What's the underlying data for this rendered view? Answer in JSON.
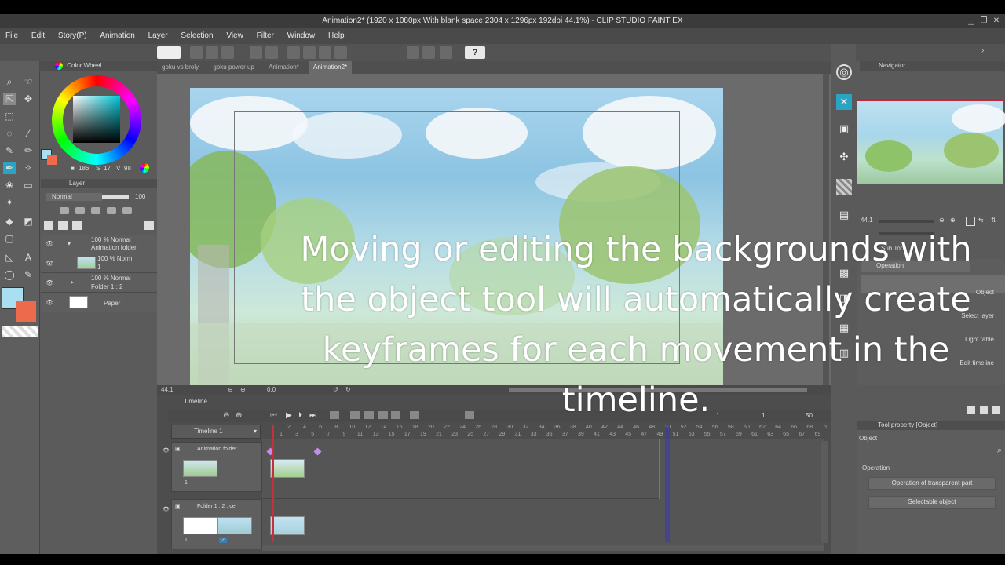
{
  "window": {
    "title": "Animation2* (1920 x 1080px With blank space:2304 x 1296px 192dpi 44.1%) - CLIP STUDIO PAINT EX"
  },
  "menu": [
    "File",
    "Edit",
    "Story(P)",
    "Animation",
    "Layer",
    "Selection",
    "View",
    "Filter",
    "Window",
    "Help"
  ],
  "doc_tabs": [
    "goku vs broly",
    "goku power up",
    "Animation*",
    "Animation2*"
  ],
  "color_wheel": {
    "header": "Color Wheel",
    "r": "186",
    "g": "17",
    "b": "98",
    "main_color": "#a9dff0",
    "sub_color": "#ee6a4d"
  },
  "layer_panel": {
    "header": "Layer",
    "blend_mode": "Normal",
    "opacity": "100",
    "layers": [
      {
        "line1": "100 % Normal",
        "line2": "Animation folder"
      },
      {
        "line1": "100 % Norm",
        "line2": "1"
      },
      {
        "line1": "100 % Normal",
        "line2": "Folder 1 : 2"
      },
      {
        "line1": "Paper",
        "line2": ""
      }
    ]
  },
  "canvas_status": {
    "zoom": "44.1",
    "angle": "0.0"
  },
  "navigator": {
    "header": "Navigator",
    "zoom": "44.1"
  },
  "sub_tool": {
    "header": "Sub Tool",
    "group": "Operation",
    "items": [
      "Object",
      "Select layer",
      "Light table",
      "Edit timeline"
    ]
  },
  "tool_property": {
    "header": "Tool property [Object]",
    "tool_name": "Object",
    "section": "Operation",
    "buttons": [
      "Operation of transparent part",
      "Selectable object"
    ]
  },
  "timeline": {
    "panel_label": "Timeline",
    "name": "Timeline 1",
    "end_frame": "50",
    "frame_numbers_top": [
      "2",
      "4",
      "6",
      "8",
      "10",
      "12",
      "14",
      "16",
      "18",
      "20",
      "22",
      "24",
      "26",
      "28",
      "30",
      "32",
      "34",
      "36",
      "38",
      "40",
      "42",
      "44",
      "46",
      "48",
      "50",
      "52",
      "54",
      "56",
      "58",
      "60",
      "62",
      "64",
      "66",
      "68",
      "70"
    ],
    "frame_numbers_bottom": [
      "1",
      "3",
      "5",
      "7",
      "9",
      "11",
      "13",
      "15",
      "17",
      "19",
      "21",
      "23",
      "25",
      "27",
      "29",
      "31",
      "33",
      "35",
      "37",
      "39",
      "41",
      "43",
      "45",
      "47",
      "49",
      "51",
      "53",
      "55",
      "57",
      "59",
      "61",
      "63",
      "65",
      "67",
      "69"
    ],
    "tracks": [
      {
        "name": "Animation folder : T",
        "cel": "1"
      },
      {
        "name": "Folder 1 : 2 : cel",
        "cel": "1",
        "cel2": "2"
      }
    ],
    "counter": [
      "1",
      "1"
    ]
  },
  "caption": "Moving or editing the backgrounds with the object tool will automatically create keyframes for each movement in the timeline."
}
